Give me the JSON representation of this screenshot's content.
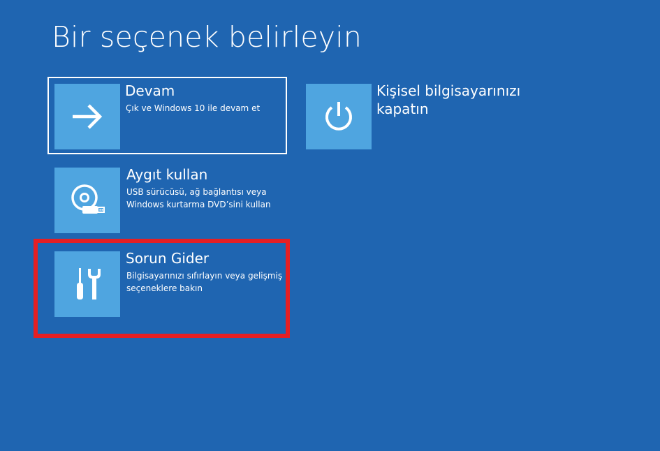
{
  "page": {
    "title": "Bir seçenek belirleyin"
  },
  "options": {
    "continue": {
      "icon": "arrow-right-icon",
      "title": "Devam",
      "description": "Çık ve Windows 10 ile devam et"
    },
    "shutdown": {
      "icon": "power-icon",
      "title_line1": "Kişisel bilgisayarınızı",
      "title_line2": "kapatın"
    },
    "use_device": {
      "icon": "disc-usb-icon",
      "title": "Aygıt kullan",
      "description_line1": "USB sürücüsü, ağ bağlantısı veya",
      "description_line2": "Windows kurtarma DVD’sini kullan"
    },
    "troubleshoot": {
      "icon": "tools-icon",
      "title": "Sorun Gider",
      "description_line1": "Bilgisayarınızı sıfırlayın veya gelişmiş",
      "description_line2": "seçeneklere bakın"
    }
  },
  "colors": {
    "background": "#1f65b1",
    "tile": "#4fa5e0",
    "highlight": "#e51f24",
    "text": "#ffffff"
  }
}
